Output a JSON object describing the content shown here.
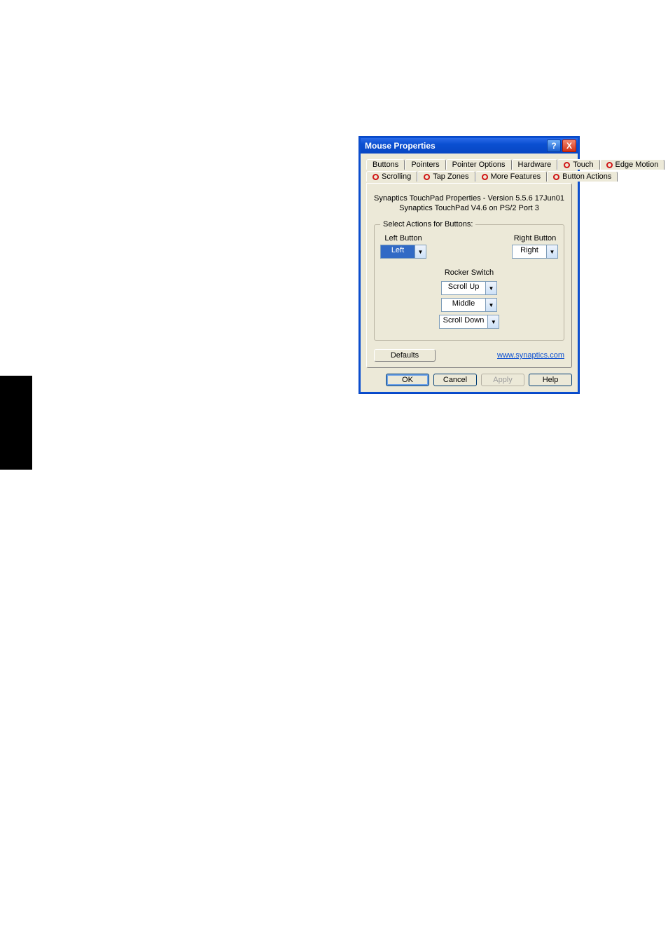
{
  "titlebar": {
    "title": "Mouse Properties",
    "help_glyph": "?",
    "close_glyph": "X"
  },
  "tabs_top": [
    {
      "label": "Buttons",
      "icon": false
    },
    {
      "label": "Pointers",
      "icon": false
    },
    {
      "label": "Pointer Options",
      "icon": false
    },
    {
      "label": "Hardware",
      "icon": false
    },
    {
      "label": "Touch",
      "icon": true
    },
    {
      "label": "Edge Motion",
      "icon": true
    }
  ],
  "tabs_bot": [
    {
      "label": "Scrolling",
      "icon": true
    },
    {
      "label": "Tap Zones",
      "icon": true
    },
    {
      "label": "More Features",
      "icon": true
    },
    {
      "label": "Button Actions",
      "icon": true,
      "active": true
    }
  ],
  "version": {
    "line1": "Synaptics TouchPad Properties - Version 5.5.6 17Jun01",
    "line2": "Synaptics TouchPad V4.6 on PS/2 Port 3"
  },
  "group": {
    "legend": "Select Actions for Buttons:",
    "left": {
      "label": "Left Button",
      "value": "Left"
    },
    "right": {
      "label": "Right Button",
      "value": "Right"
    },
    "rocker": {
      "label": "Rocker Switch",
      "up": "Scroll Up",
      "mid": "Middle",
      "down": "Scroll Down"
    }
  },
  "defaults": "Defaults",
  "link": "www.synaptics.com",
  "dialog_buttons": {
    "ok": "OK",
    "cancel": "Cancel",
    "apply": "Apply",
    "help": "Help"
  }
}
